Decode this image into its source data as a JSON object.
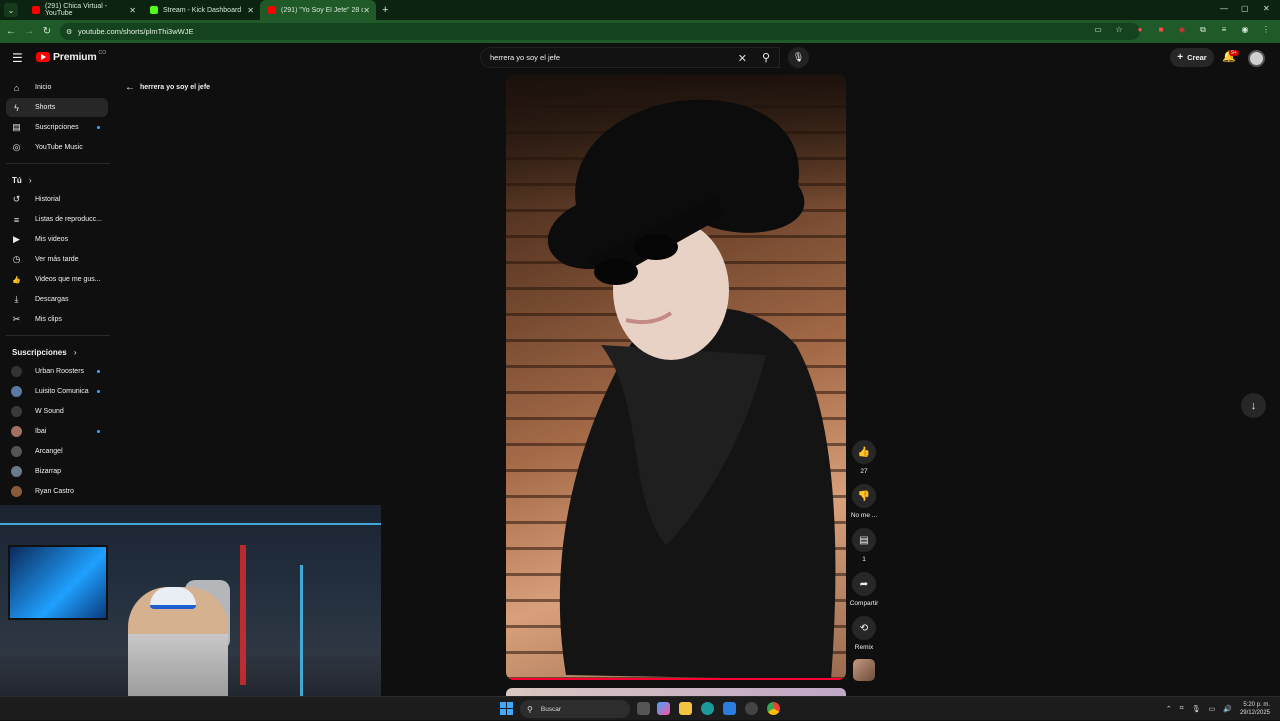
{
  "browser": {
    "tabs": [
      {
        "title": "(291) Chica Virtual - YouTube",
        "color": "#ff0000"
      },
      {
        "title": "Stream - Kick Dashboard",
        "color": "#53fc18"
      },
      {
        "title": "(291) \"Yo Soy El Jefe\" 28 de di...",
        "color": "#ff0000"
      }
    ],
    "url": "youtube.com/shorts/plmThi3wWJE",
    "new_tab": "+"
  },
  "header": {
    "logo": "Premium",
    "logo_sup": "CO",
    "search_value": "herrera yo soy el jefe",
    "create_label": "Crear",
    "notif_count": "9+"
  },
  "sidebar": {
    "main": [
      {
        "label": "Inicio",
        "icon": "home-icon",
        "glyph": "⌂"
      },
      {
        "label": "Shorts",
        "icon": "shorts-icon",
        "glyph": "ϟ"
      },
      {
        "label": "Suscripciones",
        "icon": "subscriptions-icon",
        "glyph": "▤"
      },
      {
        "label": "YouTube Music",
        "icon": "music-icon",
        "glyph": "◎"
      }
    ],
    "you_heading": "Tú",
    "you": [
      {
        "label": "Historial",
        "icon": "history-icon",
        "glyph": "↺"
      },
      {
        "label": "Listas de reproducc...",
        "icon": "playlists-icon",
        "glyph": "≡"
      },
      {
        "label": "Mis videos",
        "icon": "my-videos-icon",
        "glyph": "▶"
      },
      {
        "label": "Ver más tarde",
        "icon": "watch-later-icon",
        "glyph": "◷"
      },
      {
        "label": "Videos que me gus...",
        "icon": "liked-icon",
        "glyph": "👍"
      },
      {
        "label": "Descargas",
        "icon": "downloads-icon",
        "glyph": "⤓"
      },
      {
        "label": "Mis clips",
        "icon": "clips-icon",
        "glyph": "✂"
      }
    ],
    "subs_heading": "Suscripciones",
    "subs": [
      {
        "label": "Urban Roosters",
        "color": "#333333"
      },
      {
        "label": "Luisito Comunica",
        "color": "#5a7aa0"
      },
      {
        "label": "W Sound",
        "color": "#3a3a3a"
      },
      {
        "label": "Ibai",
        "color": "#a07060"
      },
      {
        "label": "Arcangel",
        "color": "#555555"
      },
      {
        "label": "Bizarrap",
        "color": "#6a7a8a"
      },
      {
        "label": "Ryan Castro",
        "color": "#8a5a3a"
      }
    ]
  },
  "query": {
    "text": "herrera yo soy el jefe"
  },
  "actions": {
    "like_count": "27",
    "dislike_label": "No me ...",
    "comments_count": "1",
    "share_label": "Compartir",
    "remix_label": "Remix"
  },
  "taskbar": {
    "search_label": "Buscar",
    "time": "5:20 p. m.",
    "date": "29/12/2025"
  }
}
